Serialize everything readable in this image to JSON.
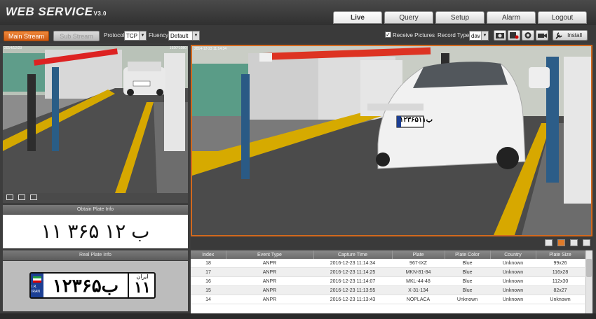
{
  "app": {
    "title": "WEB  SERVICE",
    "version": "V3.0"
  },
  "nav": {
    "tabs": [
      {
        "label": "Live",
        "active": true
      },
      {
        "label": "Query",
        "active": false
      },
      {
        "label": "Setup",
        "active": false
      },
      {
        "label": "Alarm",
        "active": false
      },
      {
        "label": "Logout",
        "active": false
      }
    ]
  },
  "toolbar": {
    "main_stream_label": "Main Stream",
    "sub_stream_label": "Sub Stream",
    "protocol_label": "Protocol",
    "protocol_value": "TCP",
    "fluency_label": "Fluency",
    "fluency_value": "Default",
    "receive_pictures_label": "Receive Pictures",
    "receive_pictures_checked": true,
    "record_type_label": "Record Type",
    "record_type_value": "dav",
    "install_label": "Install",
    "icons": [
      "snapshot-icon",
      "record-icon",
      "talk-icon",
      "camera-icon",
      "install-icon"
    ]
  },
  "left_camera": {
    "overlay_left": "2014/12/23",
    "overlay_right": "1920*1080",
    "controls": [
      "fit-icon",
      "zoom-icon",
      "fullscreen-icon"
    ]
  },
  "obtain_plate": {
    "title": "Obtain Plate Info",
    "plate_text": "۱۱ ۳۶۵ ب ۱۲"
  },
  "real_plate": {
    "title": "Real Plate Info",
    "plate_main": "۱۲ب۳۶۵",
    "plate_region": "۱۱",
    "plate_region_label": "ایران",
    "country_code_top": "I.R.",
    "country_code_bottom": "IRAN",
    "flag_colors": [
      "#239f40",
      "#ffffff",
      "#da0000"
    ]
  },
  "big_camera": {
    "overlay_text": "2014-12-23 11:14:34",
    "car_plate": "۱۲ب۳۶۵۱۱",
    "view_controls": [
      "single-view-icon",
      "quad-view-icon",
      "grid-view-icon",
      "fullscreen-icon"
    ]
  },
  "events_table": {
    "columns": [
      "Index",
      "Event Type",
      "Capture Time",
      "Plate",
      "Plate Color",
      "Country",
      "Plate Size"
    ],
    "rows": [
      [
        "18",
        "ANPR",
        "2016-12-23 11:14:34",
        "967-IXZ",
        "Blue",
        "Unknown",
        "99x26"
      ],
      [
        "17",
        "ANPR",
        "2016-12-23 11:14:25",
        "MKN-81-84",
        "Blue",
        "Unknown",
        "116x28"
      ],
      [
        "16",
        "ANPR",
        "2016-12-23 11:14:07",
        "MKL-44-48",
        "Blue",
        "Unknown",
        "112x30"
      ],
      [
        "15",
        "ANPR",
        "2016-12-23 11:13:55",
        "X-31-134",
        "Blue",
        "Unknown",
        "82x27"
      ],
      [
        "14",
        "ANPR",
        "2016-12-23 11:13:43",
        "NOPLACA",
        "Unknown",
        "Unknown",
        "Unknown"
      ]
    ]
  }
}
